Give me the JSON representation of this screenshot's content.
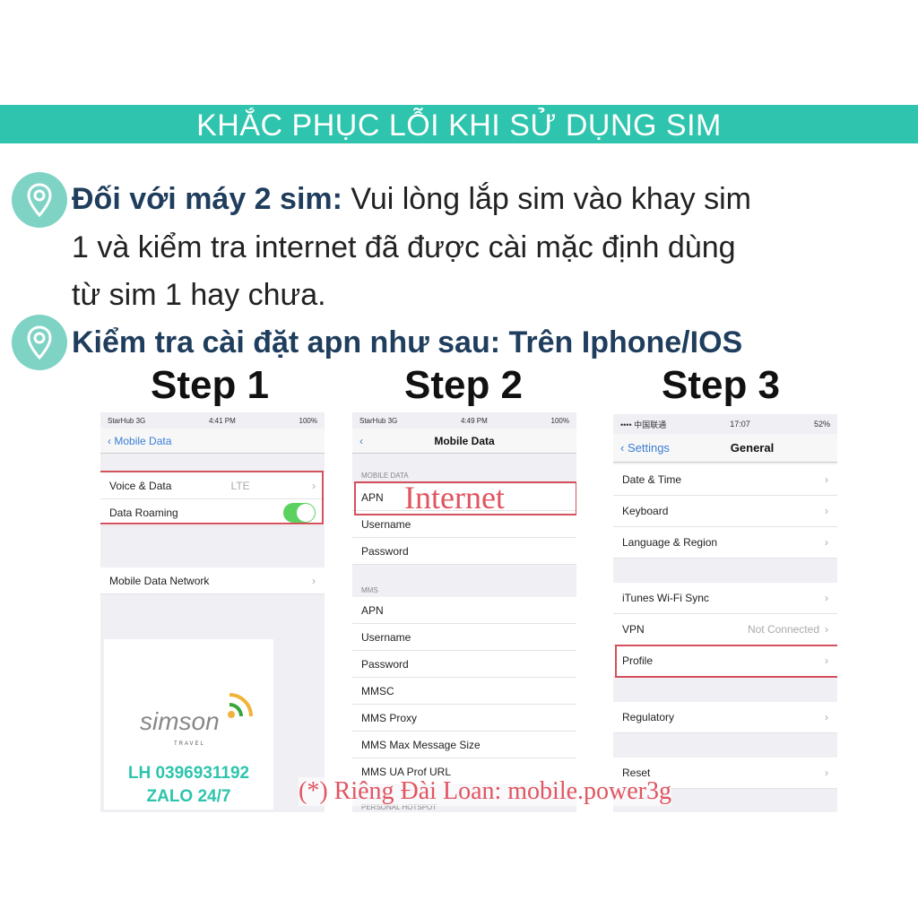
{
  "banner": {
    "title": "KHẮC PHỤC LỖI KHI SỬ DỤNG SIM",
    "color": "#2ec4ad"
  },
  "bullets": [
    {
      "icon": "location-pin-icon",
      "bold": "Đối với máy 2 sim:",
      "text": " Vui lòng lắp sim vào khay sim",
      "line2": "1 và kiểm tra internet đã được cài mặc định dùng",
      "line3": "từ sim 1 hay chưa."
    },
    {
      "icon": "location-pin-icon",
      "bold": "Kiểm tra cài đặt apn như sau: Trên Iphone/IOS"
    }
  ],
  "steps": [
    {
      "label": "Step 1",
      "status": {
        "carrier": "StarHub  3G",
        "time": "4:41 PM",
        "battery": "100%"
      },
      "back": "Mobile Data",
      "rows": [
        {
          "label": "Voice & Data",
          "value": "LTE"
        },
        {
          "label": "Data Roaming",
          "toggle": true
        },
        {
          "label": "Mobile Data Network"
        }
      ]
    },
    {
      "label": "Step 2",
      "status": {
        "carrier": "StarHub  3G",
        "time": "4:49 PM",
        "battery": "100%"
      },
      "title": "Mobile Data",
      "header1": "MOBILE DATA",
      "header2": "MMS",
      "header3": "PERSONAL HOTSPOT",
      "apn_value": "Internet",
      "rows1": [
        "APN",
        "Username",
        "Password"
      ],
      "rows2": [
        "APN",
        "Username",
        "Password",
        "MMSC",
        "MMS Proxy",
        "MMS Max Message Size",
        "MMS UA Prof URL"
      ]
    },
    {
      "label": "Step 3",
      "status": {
        "carrier": "•••• 中国联通",
        "time": "17:07",
        "battery": "52%"
      },
      "back": "Settings",
      "title": "General",
      "rows": [
        {
          "label": "Date & Time"
        },
        {
          "label": "Keyboard"
        },
        {
          "label": "Language & Region"
        },
        {
          "label": "iTunes Wi-Fi Sync"
        },
        {
          "label": "VPN",
          "value": "Not Connected"
        },
        {
          "label": "Profile"
        },
        {
          "label": "Regulatory"
        },
        {
          "label": "Reset"
        }
      ]
    }
  ],
  "logo": {
    "brand": "simson",
    "sub": "TRAVEL",
    "phone": "LH 0396931192",
    "zalo": "ZALO 24/7"
  },
  "footnote": "(*) Riêng Đài Loan: mobile.power3g",
  "colors": {
    "accent": "#2ec4ad",
    "highlight": "#e05560",
    "heading": "#1f3d5c"
  }
}
